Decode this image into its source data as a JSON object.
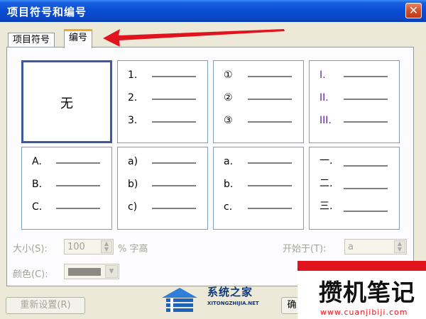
{
  "window": {
    "title": "项目符号和编号",
    "close_glyph": "✕"
  },
  "tabs": [
    {
      "label": "项目符号",
      "active": false
    },
    {
      "label": "编号",
      "active": true
    }
  ],
  "grid": {
    "none_label": "无",
    "styles": [
      {
        "markers": [
          "1.",
          "2.",
          "3."
        ]
      },
      {
        "markers": [
          "①",
          "②",
          "③"
        ]
      },
      {
        "markers": [
          "I.",
          "II.",
          "III."
        ]
      },
      {
        "markers": [
          "A.",
          "B.",
          "C."
        ]
      },
      {
        "markers": [
          "a)",
          "b)",
          "c)"
        ]
      },
      {
        "markers": [
          "a.",
          "b.",
          "c."
        ]
      },
      {
        "markers": [
          "一.",
          "二.",
          "三."
        ]
      }
    ]
  },
  "controls": {
    "size_label": "大小(S):",
    "size_value": "100",
    "size_unit": "% 字高",
    "start_label": "开始于(T):",
    "start_value": "a",
    "color_label": "颜色(C):",
    "color_swatch": "#8a8a82"
  },
  "buttons": {
    "reset": "重新设置(R)",
    "ok": "确"
  },
  "watermarks": {
    "left_title": "系统之家",
    "left_url": "XITONGZHIJIA.NET",
    "right_title": "攒机笔记",
    "right_url": "www.cuanjibiji.com"
  },
  "colors": {
    "accent": "#3d58a3",
    "tab_highlight": "#f5a623",
    "annotation": "#e1141e"
  }
}
